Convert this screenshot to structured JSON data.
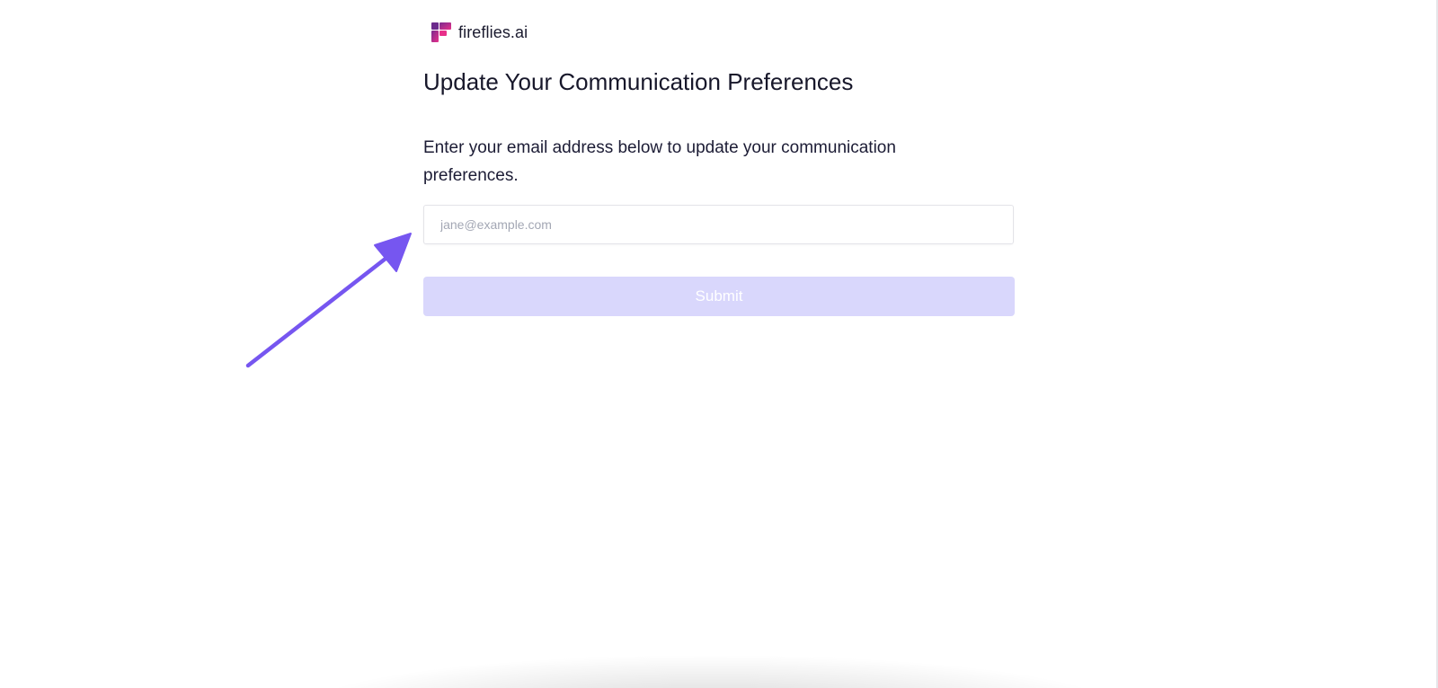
{
  "brand": {
    "name": "fireflies.ai",
    "logo_icon": "fireflies-logo-icon",
    "logo_color": "#c5267f"
  },
  "page": {
    "title": "Update Your Communication Preferences",
    "description": "Enter your email address below to update your communication preferences."
  },
  "form": {
    "email_placeholder": "jane@example.com",
    "email_value": "",
    "submit_label": "Submit",
    "submit_color": "#d9d7fc"
  },
  "annotation": {
    "icon": "pointer-arrow-icon",
    "color": "#7656f0"
  }
}
